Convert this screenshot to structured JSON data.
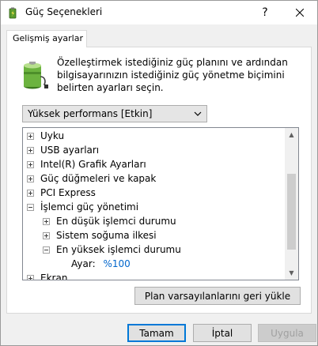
{
  "window": {
    "title": "Güç Seçenekleri",
    "help_label": "?"
  },
  "tab": {
    "label": "Gelişmiş ayarlar"
  },
  "description": "Özelleştirmek istediğiniz güç planını ve ardından bilgisayarınızın istediğiniz güç yönetme biçimini belirten ayarları seçin.",
  "plan_select": {
    "value": "Yüksek performans [Etkin]"
  },
  "tree": {
    "items": [
      {
        "label": "Uyku",
        "state": "collapsed"
      },
      {
        "label": "USB ayarları",
        "state": "collapsed"
      },
      {
        "label": "Intel(R) Grafik Ayarları",
        "state": "collapsed"
      },
      {
        "label": "Güç düğmeleri ve kapak",
        "state": "collapsed"
      },
      {
        "label": "PCI Express",
        "state": "collapsed"
      },
      {
        "label": "İşlemci güç yönetimi",
        "state": "expanded"
      },
      {
        "label": "En düşük işlemci durumu",
        "state": "collapsed"
      },
      {
        "label": "Sistem soğuma ilkesi",
        "state": "collapsed"
      },
      {
        "label": "En yüksek işlemci durumu",
        "state": "expanded"
      },
      {
        "label": "Ayar:",
        "value": "%100"
      },
      {
        "label": "Ekran",
        "state": "collapsed"
      }
    ]
  },
  "buttons": {
    "restore": "Plan varsayılanlarını geri yükle",
    "ok": "Tamam",
    "cancel": "İptal",
    "apply": "Uygula"
  },
  "colors": {
    "accent": "#0078d7",
    "value_blue": "#0066cc"
  }
}
